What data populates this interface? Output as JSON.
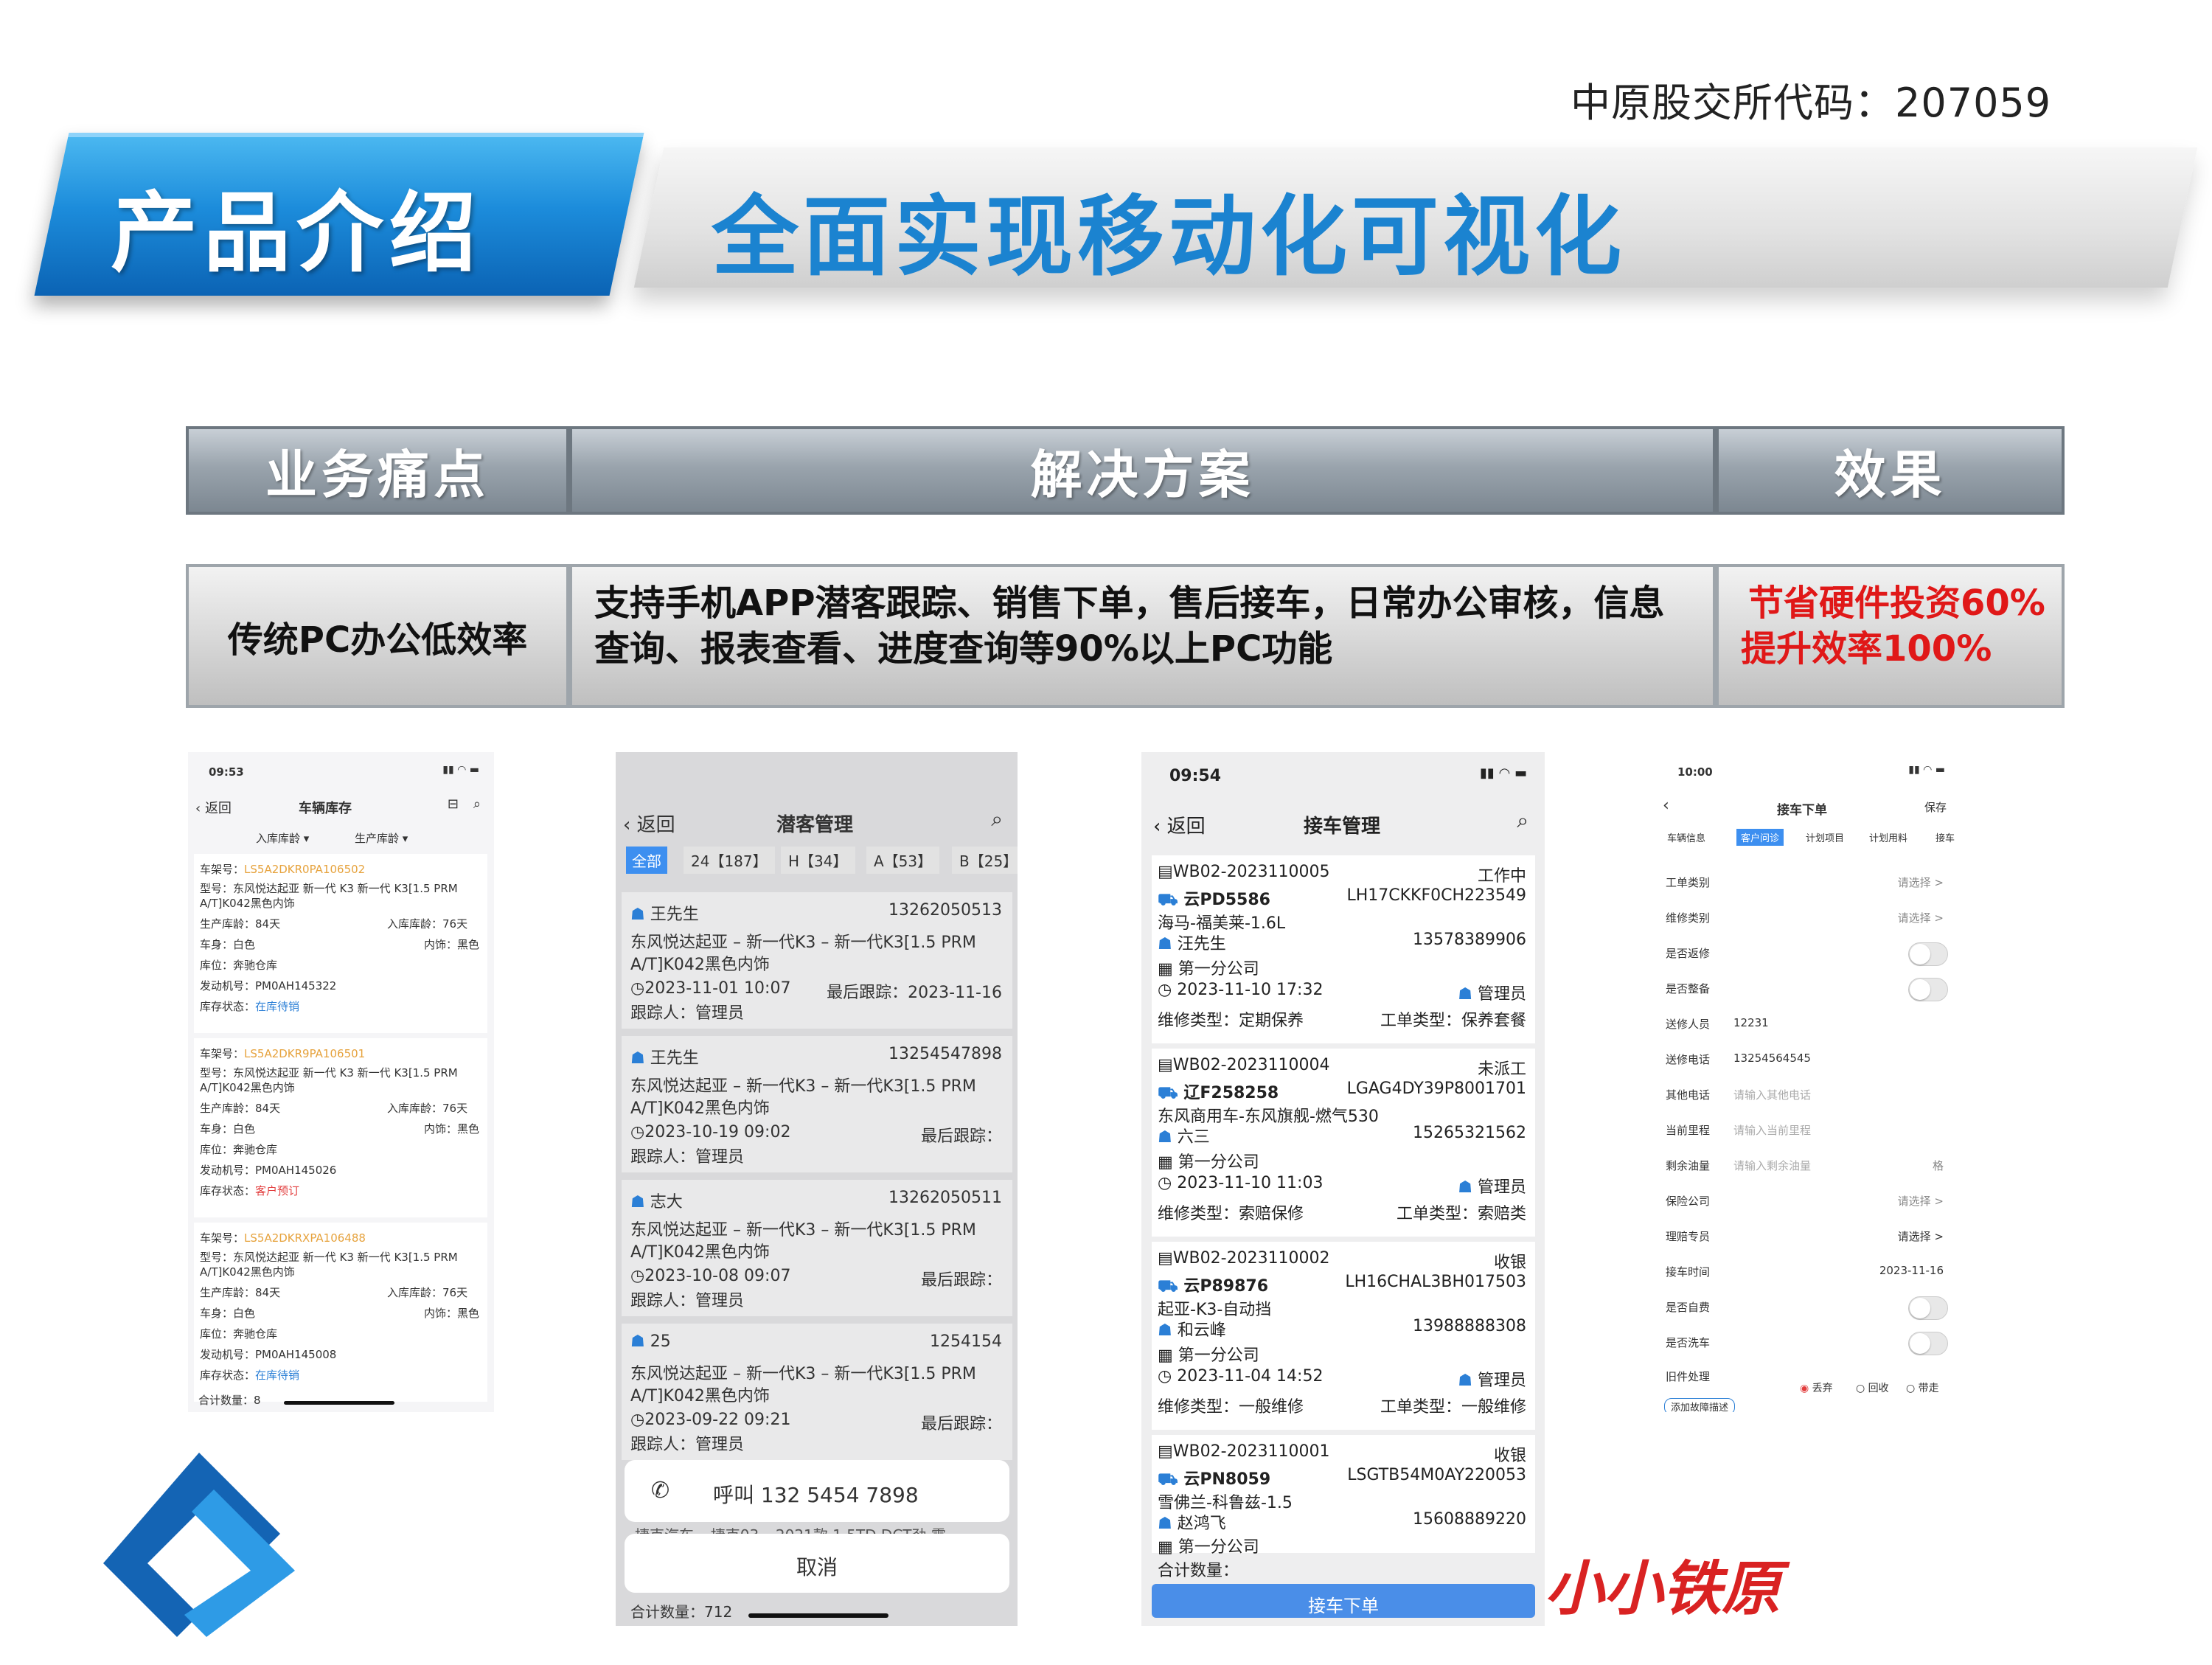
{
  "header": {
    "stock_code": "中原股交所代码：207059",
    "product_label": "产品介绍",
    "slogan": "全面实现移动化可视化"
  },
  "table": {
    "headers": [
      "业务痛点",
      "解决方案",
      "效果"
    ],
    "pain_point": "传统PC办公低效率",
    "solution_line1": "支持手机APP潜客跟踪、销售下单，售后接车，日常办公审核，信息",
    "solution_line2": "查询、报表查看、进度查询等90%以上PC功能",
    "effect_line1": "节省硬件投资60%",
    "effect_line2": "提升效率100%"
  },
  "phone1": {
    "time": "09:53",
    "back": "返回",
    "title": "车辆库存",
    "filter1": "入库库龄 ▾",
    "filter2": "生产库龄 ▾",
    "cars": [
      {
        "vin_label": "车架号：",
        "vin": "LS5A2DKR0PA106502",
        "model": "型号：东风悦达起亚 新一代 K3 新一代 K3[1.5 PRM",
        "model2": "A/T]K042黑色内饰",
        "prod_age": "生产库龄：84天",
        "in_age": "入库库龄：76天",
        "body": "车身：白色",
        "interior": "内饰：黑色",
        "depot": "库位：奔驰仓库",
        "engine": "发动机号：PM0AH145322",
        "status_label": "库存状态：",
        "status": "在库待销"
      },
      {
        "vin_label": "车架号：",
        "vin": "LS5A2DKR9PA106501",
        "model": "型号：东风悦达起亚 新一代 K3 新一代 K3[1.5 PRM",
        "model2": "A/T]K042黑色内饰",
        "prod_age": "生产库龄：84天",
        "in_age": "入库库龄：76天",
        "body": "车身：白色",
        "interior": "内饰：黑色",
        "depot": "库位：奔驰仓库",
        "engine": "发动机号：PM0AH145026",
        "status_label": "库存状态：",
        "status": "客户预订"
      },
      {
        "vin_label": "车架号：",
        "vin": "LS5A2DKRXPA106488",
        "model": "型号：东风悦达起亚 新一代 K3 新一代 K3[1.5 PRM",
        "model2": "A/T]K042黑色内饰",
        "prod_age": "生产库龄：84天",
        "in_age": "入库库龄：76天",
        "body": "车身：白色",
        "interior": "内饰：黑色",
        "depot": "库位：奔驰仓库",
        "engine": "发动机号：PM0AH145008",
        "status_label": "库存状态：",
        "status": "在库待销"
      }
    ],
    "total_label": "合计数量：",
    "total": "8"
  },
  "phone2": {
    "back": "返回",
    "title": "潜客管理",
    "tabs": [
      "全部",
      "24【187】",
      "H【34】",
      "A【53】",
      "B【25】"
    ],
    "leads": [
      {
        "name": "王先生",
        "phone": "13262050513",
        "car1": "东风悦达起亚 – 新一代K3 – 新一代K3[1.5 PRM",
        "car2": "A/T]K042黑色内饰",
        "time": "2023-11-01 10:07",
        "last": "最后跟踪：2023-11-16",
        "follower": "跟踪人：管理员"
      },
      {
        "name": "王先生",
        "phone": "13254547898",
        "car1": "东风悦达起亚 – 新一代K3 – 新一代K3[1.5 PRM",
        "car2": "A/T]K042黑色内饰",
        "time": "2023-10-19 09:02",
        "last": "最后跟踪：",
        "follower": "跟踪人：管理员"
      },
      {
        "name": "志大",
        "phone": "13262050511",
        "car1": "东风悦达起亚 – 新一代K3 – 新一代K3[1.5 PRM",
        "car2": "A/T]K042黑色内饰",
        "time": "2023-10-08 09:07",
        "last": "最后跟踪：",
        "follower": "跟踪人：管理员"
      },
      {
        "name": "25",
        "phone": "1254154",
        "car1": "东风悦达起亚 – 新一代K3 – 新一代K3[1.5 PRM",
        "car2": "A/T]K042黑色内饰",
        "time": "2023-09-22 09:21",
        "last": "最后跟踪：",
        "follower": "跟踪人：管理员"
      }
    ],
    "call": "呼叫 132 5454 7898",
    "peek": "捷克汽车 – 捷克03 – 2021款 1.5TD DCT劲 霸",
    "cancel": "取消",
    "total_label": "合计数量：",
    "total": "712"
  },
  "phone3": {
    "time": "09:54",
    "back": "返回",
    "title": "接车管理",
    "orders": [
      {
        "no": "WB02-2023110005",
        "status": "工作中",
        "plate": "云PD5586",
        "vin": "LH17CKKF0CH223549",
        "model": "海马-福美莱-1.6L",
        "owner": "汪先生",
        "phone": "13578389906",
        "company": "第一分公司",
        "time": "2023-11-10 17:32",
        "admin": "管理员",
        "repair": "维修类型：定期保养",
        "work": "工单类型：保养套餐"
      },
      {
        "no": "WB02-2023110004",
        "status": "未派工",
        "plate": "辽F258258",
        "vin": "LGAG4DY39P8001701",
        "model": "东风商用车-东风旗舰-燃气530",
        "owner": "六三",
        "phone": "15265321562",
        "company": "第一分公司",
        "time": "2023-11-10 11:03",
        "admin": "管理员",
        "repair": "维修类型：索赔保修",
        "work": "工单类型：索赔类"
      },
      {
        "no": "WB02-2023110002",
        "status": "收银",
        "plate": "云P89876",
        "vin": "LH16CHAL3BH017503",
        "model": "起亚-K3-自动挡",
        "owner": "和云峰",
        "phone": "13988888308",
        "company": "第一分公司",
        "time": "2023-11-04 14:52",
        "admin": "管理员",
        "repair": "维修类型：一般维修",
        "work": "工单类型：一般维修"
      },
      {
        "no": "WB02-2023110001",
        "status": "收银",
        "plate": "云PN8059",
        "vin": "LSGTB54M0AY220053",
        "model": "雪佛兰-科鲁兹-1.5",
        "owner": "赵鸿飞",
        "phone": "15608889220",
        "company": "第一分公司"
      }
    ],
    "total_label": "合计数量：",
    "button": "接车下单"
  },
  "phone4": {
    "time": "10:00",
    "title": "接车下单",
    "save": "保存",
    "tabs": [
      "车辆信息",
      "客户问诊",
      "计划项目",
      "计划用料",
      "接车"
    ],
    "rows": [
      {
        "label": "工单类别",
        "value": "请选择 >",
        "label_red": true
      },
      {
        "label": "维修类别",
        "value": "请选择 >",
        "label_red": true
      },
      {
        "label": "是否返修",
        "value": "",
        "toggle": true
      },
      {
        "label": "是否整备",
        "value": "",
        "toggle": true
      },
      {
        "label": "送修人员",
        "value": "12231",
        "label_red": true
      },
      {
        "label": "送修电话",
        "value": "13254564545",
        "label_red": true
      },
      {
        "label": "其他电话",
        "value": "请输入其他电话"
      },
      {
        "label": "当前里程",
        "value": "请输入当前里程",
        "label_red": true
      },
      {
        "label": "剩余油量",
        "value": "请输入剩余油量",
        "label_red": true,
        "suffix": "格"
      },
      {
        "label": "保险公司",
        "value": "请选择 >"
      },
      {
        "label": "理赔专员",
        "value": "请选择 >"
      },
      {
        "label": "接车时间",
        "value": "2023-11-16"
      },
      {
        "label": "是否自费",
        "value": "",
        "toggle": true
      },
      {
        "label": "是否洗车",
        "value": "",
        "toggle": true
      },
      {
        "label": "旧件处理",
        "value": "",
        "label_red": true
      }
    ],
    "radio": [
      "丢弃",
      "回收",
      "带走"
    ],
    "add_button": "添加故障描述"
  },
  "watermark": "小小铁原",
  "colors": {
    "blue": "#1b83d0",
    "red": "#e01818",
    "orange": "#e6a23c"
  }
}
